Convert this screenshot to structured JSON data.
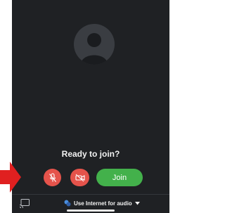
{
  "prejoin": {
    "heading": "Ready to join?",
    "join_label": "Join",
    "mic_state": "muted",
    "camera_state": "off"
  },
  "audio": {
    "option_label": "Use Internet for audio"
  },
  "colors": {
    "background": "#1f2124",
    "mute_red": "#e5534b",
    "join_green": "#43b14b",
    "arrow_red": "#e02020"
  }
}
